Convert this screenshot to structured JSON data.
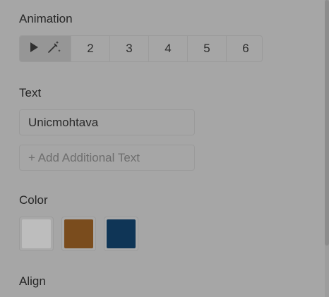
{
  "animation": {
    "title": "Animation",
    "play_icon": "play-icon",
    "magic_icon": "magic-wand-icon",
    "options": [
      "2",
      "3",
      "4",
      "5",
      "6"
    ]
  },
  "text": {
    "title": "Text",
    "value": "Unicmohtava",
    "add_label": "+ Add Additional Text"
  },
  "color": {
    "title": "Color",
    "swatches": [
      "#bdbdbd",
      "#7a4c1d",
      "#0f3556"
    ]
  },
  "align": {
    "title": "Align"
  }
}
